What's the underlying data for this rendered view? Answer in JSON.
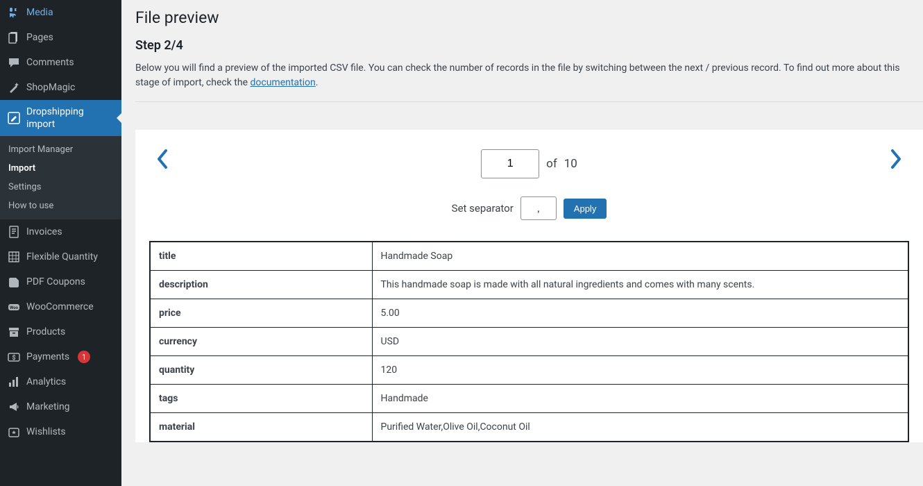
{
  "sidebar": {
    "items": [
      {
        "label": "Media",
        "icon": "media"
      },
      {
        "label": "Pages",
        "icon": "pages"
      },
      {
        "label": "Comments",
        "icon": "comments"
      },
      {
        "label": "ShopMagic",
        "icon": "wand"
      },
      {
        "label": "Dropshipping import",
        "icon": "edit",
        "active": true
      },
      {
        "label": "Invoices",
        "icon": "invoice"
      },
      {
        "label": "Flexible Quantity",
        "icon": "grid"
      },
      {
        "label": "PDF Coupons",
        "icon": "pdf"
      },
      {
        "label": "WooCommerce",
        "icon": "woo"
      },
      {
        "label": "Products",
        "icon": "archive"
      },
      {
        "label": "Payments",
        "icon": "payments",
        "badge": "1"
      },
      {
        "label": "Analytics",
        "icon": "analytics"
      },
      {
        "label": "Marketing",
        "icon": "marketing"
      },
      {
        "label": "Wishlists",
        "icon": "wishlist"
      }
    ],
    "submenu": [
      {
        "label": "Import Manager"
      },
      {
        "label": "Import",
        "current": true
      },
      {
        "label": "Settings"
      },
      {
        "label": "How to use"
      }
    ]
  },
  "header": {
    "title": "File preview",
    "step": "Step 2/4",
    "intro_a": "Below you will find a preview of the imported CSV file. You can check the number of records in the file by switching between the next / previous record. To find out more about this stage of import, check the ",
    "doc_link": "documentation",
    "intro_b": "."
  },
  "pager": {
    "page": "1",
    "of_label": "of",
    "total": "10"
  },
  "separator": {
    "label": "Set separator",
    "value": ",",
    "apply": "Apply"
  },
  "preview_rows": [
    {
      "key": "title",
      "value": "Handmade Soap"
    },
    {
      "key": "description",
      "value": "This handmade soap is made with all natural ingredients and comes with many scents."
    },
    {
      "key": "price",
      "value": "5.00"
    },
    {
      "key": "currency",
      "value": "USD"
    },
    {
      "key": "quantity",
      "value": "120"
    },
    {
      "key": "tags",
      "value": "Handmade"
    },
    {
      "key": "material",
      "value": "Purified Water,Olive Oil,Coconut Oil"
    }
  ]
}
